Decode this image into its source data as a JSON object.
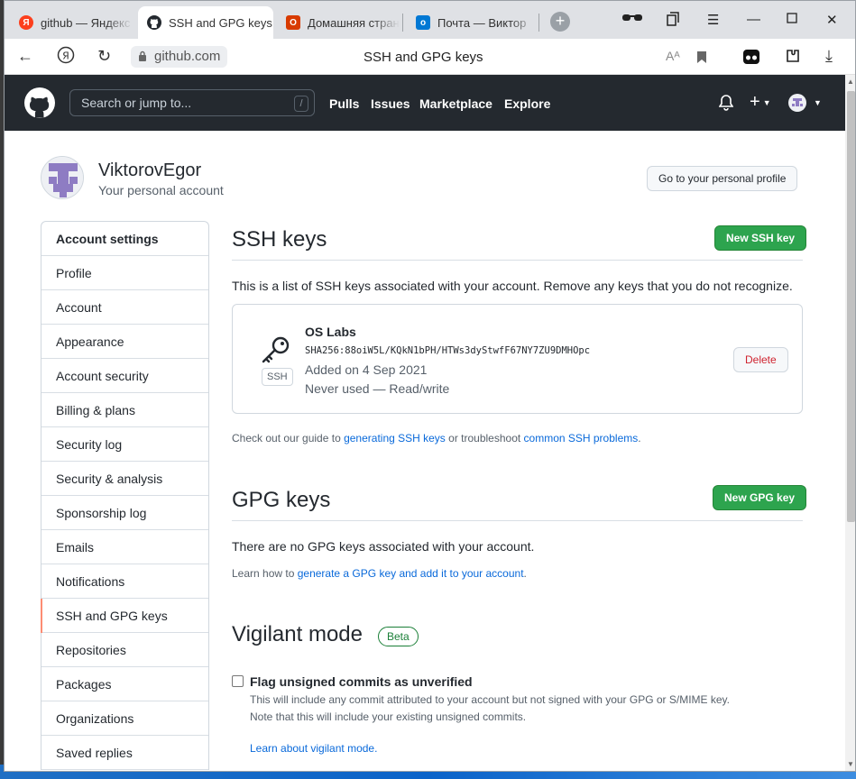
{
  "browser": {
    "tabs": [
      {
        "title": "github — Яндекс",
        "favicon": "yandex-icon",
        "active": false
      },
      {
        "title": "SSH and GPG keys",
        "favicon": "github-icon",
        "active": true
      },
      {
        "title": "Домашняя стран",
        "favicon": "office-icon",
        "active": false
      },
      {
        "title": "Почта — Виктор",
        "favicon": "outlook-icon",
        "active": false
      }
    ],
    "url": "github.com",
    "page_title": "SSH and GPG keys"
  },
  "github_header": {
    "search_placeholder": "Search or jump to...",
    "search_shortcut": "/",
    "nav": [
      "Pulls",
      "Issues",
      "Marketplace",
      "Explore"
    ]
  },
  "profile": {
    "username": "ViktorovEgor",
    "subtitle": "Your personal account",
    "profile_button": "Go to your personal profile"
  },
  "sidebar": {
    "items": [
      {
        "label": "Account settings"
      },
      {
        "label": "Profile"
      },
      {
        "label": "Account"
      },
      {
        "label": "Appearance"
      },
      {
        "label": "Account security"
      },
      {
        "label": "Billing & plans"
      },
      {
        "label": "Security log"
      },
      {
        "label": "Security & analysis"
      },
      {
        "label": "Sponsorship log"
      },
      {
        "label": "Emails"
      },
      {
        "label": "Notifications"
      },
      {
        "label": "SSH and GPG keys"
      },
      {
        "label": "Repositories"
      },
      {
        "label": "Packages"
      },
      {
        "label": "Organizations"
      },
      {
        "label": "Saved replies"
      }
    ]
  },
  "ssh": {
    "title": "SSH keys",
    "new_button": "New SSH key",
    "description": "This is a list of SSH keys associated with your account. Remove any keys that you do not recognize.",
    "key": {
      "name": "OS Labs",
      "badge": "SSH",
      "fingerprint": "SHA256:88oiW5L/KQkN1bPH/HTWs3dyStwfF67NY7ZU9DMHOpc",
      "added": "Added on 4 Sep 2021",
      "usage": "Never used — Read/write",
      "delete_button": "Delete"
    },
    "guide_prefix": "Check out our guide to ",
    "guide_link1": "generating SSH keys",
    "guide_middle": " or troubleshoot ",
    "guide_link2": "common SSH problems",
    "guide_suffix": "."
  },
  "gpg": {
    "title": "GPG keys",
    "new_button": "New GPG key",
    "empty": "There are no GPG keys associated with your account.",
    "learn_prefix": "Learn how to ",
    "learn_link": "generate a GPG key and add it to your account",
    "learn_suffix": "."
  },
  "vigilant": {
    "title": "Vigilant mode",
    "badge": "Beta",
    "checkbox_label": "Flag unsigned commits as unverified",
    "desc1": "This will include any commit attributed to your account but not signed with your GPG or S/MIME key.",
    "desc2": "Note that this will include your existing unsigned commits.",
    "learn_link": "Learn about vigilant mode."
  },
  "colors": {
    "header_bg": "#24292f",
    "primary_green": "#2da44e",
    "link_blue": "#0969da",
    "danger_red": "#cf222e",
    "selected_accent": "#fd8c73"
  }
}
